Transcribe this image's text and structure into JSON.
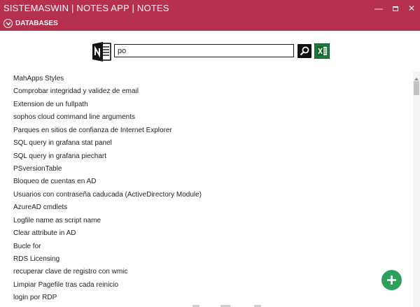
{
  "window": {
    "title": "SISTEMASWIN | NOTES APP | NOTES",
    "minimize_glyph": "—",
    "maximize_glyph": "▫",
    "close_glyph": "✕"
  },
  "databases_bar": {
    "label": "DATABASES",
    "icon": "chevron-down-circle-icon"
  },
  "search": {
    "value": "po",
    "onenote_icon": "onenote-icon",
    "search_icon": "search-icon",
    "export_icon": "excel-icon"
  },
  "notes": [
    "MahApps Styles",
    "Comprobar integridad y validez de email",
    "Extension de un fullpath",
    "sophos cloud command line arguments",
    "Parques en sitios de confianza de Internet Explorer",
    "SQL query in grafana stat panel",
    "SQL query in grafana piechart",
    "PSversionTable",
    "Bloqueo de cuentas en AD",
    "Usuarios con contraseña caducada (ActiveDirectory Module)",
    "AzureAD cmdlets",
    "Logfile name as script name",
    "Clear attribute in AD",
    "Bucle for",
    "RDS Licensing",
    "recuperar clave de registro con wmic",
    "Limpiar Pagefile tras cada reinicio",
    "login por RDP"
  ],
  "add_button": {
    "icon": "plus-icon"
  },
  "colors": {
    "accent": "#b5304e",
    "add_button": "#2ea05e",
    "excel": "#1f7a3c"
  }
}
